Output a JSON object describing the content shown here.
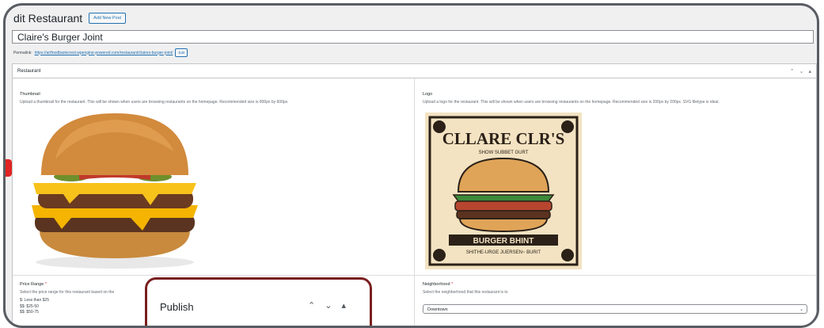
{
  "header": {
    "title": "dit Restaurant",
    "add_new_label": "Add New Post"
  },
  "post": {
    "title": "Claire's Burger Joint",
    "permalink_label": "Permalink:",
    "permalink_url": "https://artfoodbankcrest.wpengine-powered.com/restaurant/claires-burger-joint/",
    "permalink_edit": "Edit"
  },
  "metabox": {
    "title": "Restaurant",
    "controls": [
      "^",
      "v",
      "▴"
    ]
  },
  "fields": {
    "thumbnail": {
      "label": "Thumbnail",
      "description": "Upload a thumbnail for the restaurant. This will be shown when users are browsing restaurants on the homepage. Recommended size is 800px by 600px."
    },
    "logo": {
      "label": "Logo",
      "description": "Upload a logo for the restaurant. This will be shown when users are browsing restaurants on the homepage. Recommended size is 200px by 200px. SVG filetype is ideal.",
      "text_top": "CLLARE CLR'S",
      "text_sub": "SHOW SUBBET GURT",
      "text_banner": "BURGER BHINT",
      "text_bottom": "SHITHE-URGE JUERSEN~ BURIT"
    },
    "price_range": {
      "label": "Price Range",
      "required": "*",
      "description": "Select the price range for this restaurant based on the",
      "options": [
        "$: Less than $25",
        "$$: $25-50",
        "$$: $50-75"
      ]
    },
    "neighborhood": {
      "label": "Neighborhood",
      "required": "*",
      "description": "Select the neighborhood that this restaurant is in.",
      "value": "Downtown"
    }
  },
  "publish": {
    "title": "Publish",
    "controls": [
      "^",
      "v",
      "▴"
    ]
  },
  "colors": {
    "accent": "#2271b1",
    "required": "#d63638",
    "publish_border": "#7a1f1f"
  }
}
